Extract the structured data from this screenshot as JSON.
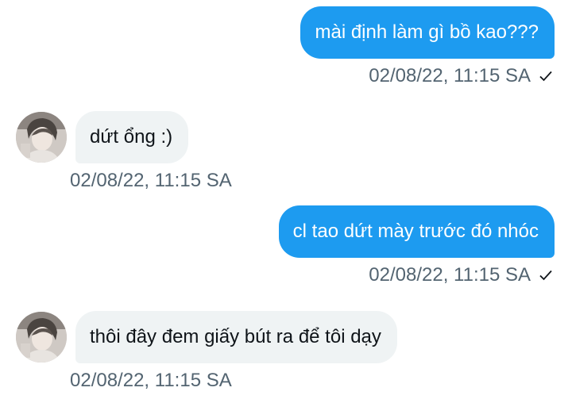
{
  "messages": [
    {
      "direction": "sent",
      "text": "mài định làm gì bồ kao???",
      "timestamp": "02/08/22, 11:15 SA",
      "status_icon": "check-icon"
    },
    {
      "direction": "received",
      "text": "dứt ổng :)",
      "timestamp": "02/08/22, 11:15 SA",
      "avatar_icon": "avatar"
    },
    {
      "direction": "sent",
      "text": "cl tao dứt mày trước đó nhóc",
      "timestamp": "02/08/22, 11:15 SA",
      "status_icon": "check-icon"
    },
    {
      "direction": "received",
      "text": "thôi đây đem giấy bút ra để tôi dạy",
      "timestamp": "02/08/22, 11:15 SA",
      "avatar_icon": "avatar"
    }
  ],
  "colors": {
    "sent_bubble": "#1d9bf0",
    "received_bubble": "#eff3f4",
    "timestamp_text": "#536471",
    "page_background": "#ffffff"
  }
}
